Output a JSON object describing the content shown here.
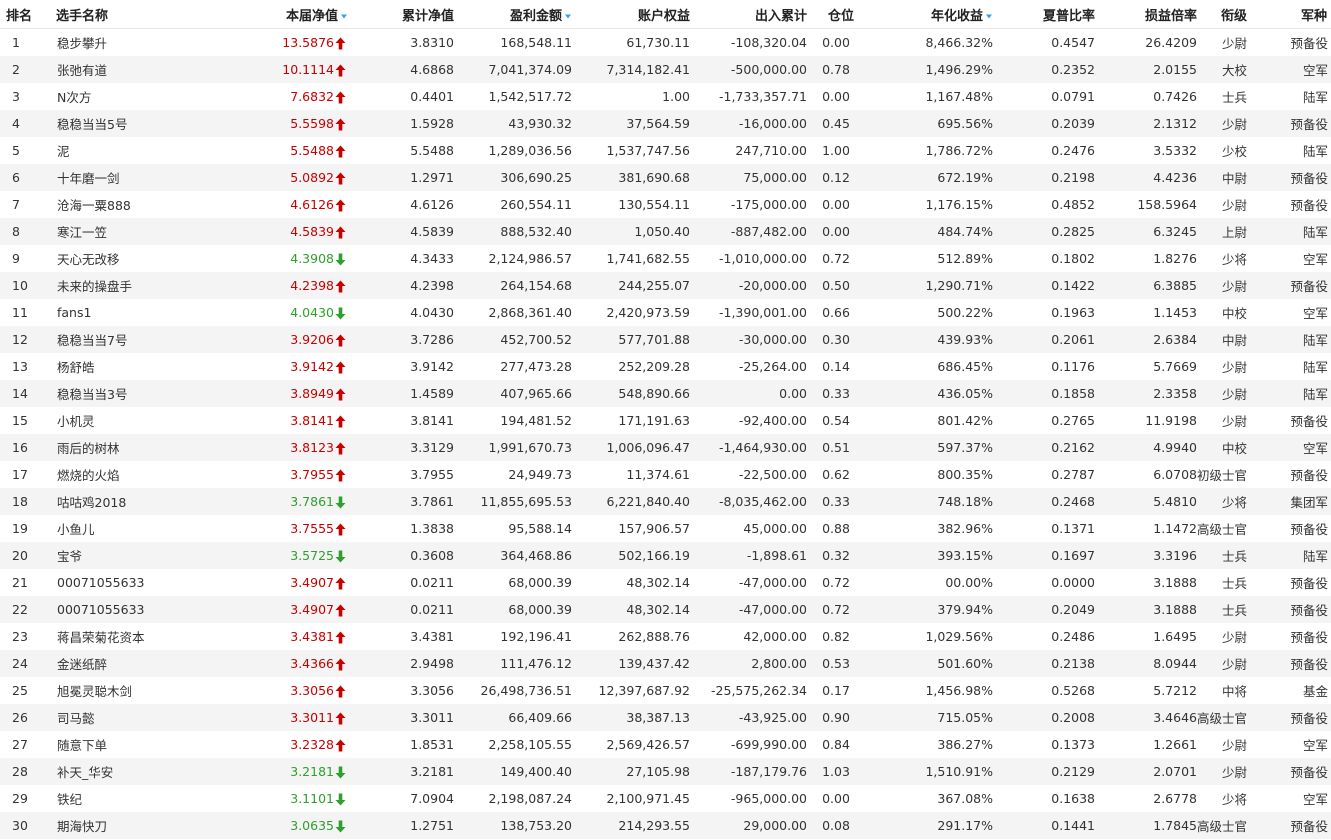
{
  "colors": {
    "up": "#c80000",
    "down": "#2da02d",
    "sort_icon": "#3aa0e6",
    "stripe": "#f4f4f4"
  },
  "header": {
    "rank": "排名",
    "name": "选手名称",
    "nav": "本届净值",
    "cum_nav": "累计净值",
    "profit": "盈利金额",
    "equity": "账户权益",
    "inout": "出入累计",
    "position": "仓位",
    "annual": "年化收益",
    "sharpe": "夏普比率",
    "pl_ratio": "损益倍率",
    "rank_title": "衔级",
    "army": "军种"
  },
  "sortable_icon": "sort-down-triangle-icon",
  "rows": [
    {
      "rank": "1",
      "name": "稳步攀升",
      "nav": "13.5876",
      "dir": "up",
      "cum_nav": "3.8310",
      "profit": "168,548.11",
      "equity": "61,730.11",
      "inout": "-108,320.04",
      "position": "0.00",
      "annual": "8,466.32%",
      "sharpe": "0.4547",
      "pl_ratio": "26.4209",
      "title": "少尉",
      "army": "预备役"
    },
    {
      "rank": "2",
      "name": "张弛有道",
      "nav": "10.1114",
      "dir": "up",
      "cum_nav": "4.6868",
      "profit": "7,041,374.09",
      "equity": "7,314,182.41",
      "inout": "-500,000.00",
      "position": "0.78",
      "annual": "1,496.29%",
      "sharpe": "0.2352",
      "pl_ratio": "2.0155",
      "title": "大校",
      "army": "空军"
    },
    {
      "rank": "3",
      "name": "N次方",
      "nav": "7.6832",
      "dir": "up",
      "cum_nav": "0.4401",
      "profit": "1,542,517.72",
      "equity": "1.00",
      "inout": "-1,733,357.71",
      "position": "0.00",
      "annual": "1,167.48%",
      "sharpe": "0.0791",
      "pl_ratio": "0.7426",
      "title": "士兵",
      "army": "陆军"
    },
    {
      "rank": "4",
      "name": "稳稳当当5号",
      "nav": "5.5598",
      "dir": "up",
      "cum_nav": "1.5928",
      "profit": "43,930.32",
      "equity": "37,564.59",
      "inout": "-16,000.00",
      "position": "0.45",
      "annual": "695.56%",
      "sharpe": "0.2039",
      "pl_ratio": "2.1312",
      "title": "少尉",
      "army": "预备役"
    },
    {
      "rank": "5",
      "name": "泥",
      "nav": "5.5488",
      "dir": "up",
      "cum_nav": "5.5488",
      "profit": "1,289,036.56",
      "equity": "1,537,747.56",
      "inout": "247,710.00",
      "position": "1.00",
      "annual": "1,786.72%",
      "sharpe": "0.2476",
      "pl_ratio": "3.5332",
      "title": "少校",
      "army": "陆军"
    },
    {
      "rank": "6",
      "name": "十年磨一剑",
      "nav": "5.0892",
      "dir": "up",
      "cum_nav": "1.2971",
      "profit": "306,690.25",
      "equity": "381,690.68",
      "inout": "75,000.00",
      "position": "0.12",
      "annual": "672.19%",
      "sharpe": "0.2198",
      "pl_ratio": "4.4236",
      "title": "中尉",
      "army": "预备役"
    },
    {
      "rank": "7",
      "name": "沧海一粟888",
      "nav": "4.6126",
      "dir": "up",
      "cum_nav": "4.6126",
      "profit": "260,554.11",
      "equity": "130,554.11",
      "inout": "-175,000.00",
      "position": "0.00",
      "annual": "1,176.15%",
      "sharpe": "0.4852",
      "pl_ratio": "158.5964",
      "title": "少尉",
      "army": "预备役"
    },
    {
      "rank": "8",
      "name": "寒江一笠",
      "nav": "4.5839",
      "dir": "up",
      "cum_nav": "4.5839",
      "profit": "888,532.40",
      "equity": "1,050.40",
      "inout": "-887,482.00",
      "position": "0.00",
      "annual": "484.74%",
      "sharpe": "0.2825",
      "pl_ratio": "6.3245",
      "title": "上尉",
      "army": "陆军"
    },
    {
      "rank": "9",
      "name": "天心无改移",
      "nav": "4.3908",
      "dir": "down",
      "cum_nav": "4.3433",
      "profit": "2,124,986.57",
      "equity": "1,741,682.55",
      "inout": "-1,010,000.00",
      "position": "0.72",
      "annual": "512.89%",
      "sharpe": "0.1802",
      "pl_ratio": "1.8276",
      "title": "少将",
      "army": "空军"
    },
    {
      "rank": "10",
      "name": "未来的操盘手",
      "nav": "4.2398",
      "dir": "up",
      "cum_nav": "4.2398",
      "profit": "264,154.68",
      "equity": "244,255.07",
      "inout": "-20,000.00",
      "position": "0.50",
      "annual": "1,290.71%",
      "sharpe": "0.1422",
      "pl_ratio": "6.3885",
      "title": "少尉",
      "army": "预备役"
    },
    {
      "rank": "11",
      "name": "fans1",
      "nav": "4.0430",
      "dir": "down",
      "cum_nav": "4.0430",
      "profit": "2,868,361.40",
      "equity": "2,420,973.59",
      "inout": "-1,390,001.00",
      "position": "0.66",
      "annual": "500.22%",
      "sharpe": "0.1963",
      "pl_ratio": "1.1453",
      "title": "中校",
      "army": "空军"
    },
    {
      "rank": "12",
      "name": "稳稳当当7号",
      "nav": "3.9206",
      "dir": "up",
      "cum_nav": "3.7286",
      "profit": "452,700.52",
      "equity": "577,701.88",
      "inout": "-30,000.00",
      "position": "0.30",
      "annual": "439.93%",
      "sharpe": "0.2061",
      "pl_ratio": "2.6384",
      "title": "中尉",
      "army": "陆军"
    },
    {
      "rank": "13",
      "name": "杨舒皓",
      "nav": "3.9142",
      "dir": "up",
      "cum_nav": "3.9142",
      "profit": "277,473.28",
      "equity": "252,209.28",
      "inout": "-25,264.00",
      "position": "0.14",
      "annual": "686.45%",
      "sharpe": "0.1176",
      "pl_ratio": "5.7669",
      "title": "少尉",
      "army": "陆军"
    },
    {
      "rank": "14",
      "name": "稳稳当当3号",
      "nav": "3.8949",
      "dir": "up",
      "cum_nav": "1.4589",
      "profit": "407,965.66",
      "equity": "548,890.66",
      "inout": "0.00",
      "position": "0.33",
      "annual": "436.05%",
      "sharpe": "0.1858",
      "pl_ratio": "2.3358",
      "title": "少尉",
      "army": "陆军"
    },
    {
      "rank": "15",
      "name": "小机灵",
      "nav": "3.8141",
      "dir": "up",
      "cum_nav": "3.8141",
      "profit": "194,481.52",
      "equity": "171,191.63",
      "inout": "-92,400.00",
      "position": "0.54",
      "annual": "801.42%",
      "sharpe": "0.2765",
      "pl_ratio": "11.9198",
      "title": "少尉",
      "army": "预备役"
    },
    {
      "rank": "16",
      "name": "雨后的树林",
      "nav": "3.8123",
      "dir": "up",
      "cum_nav": "3.3129",
      "profit": "1,991,670.73",
      "equity": "1,006,096.47",
      "inout": "-1,464,930.00",
      "position": "0.51",
      "annual": "597.37%",
      "sharpe": "0.2162",
      "pl_ratio": "4.9940",
      "title": "中校",
      "army": "空军"
    },
    {
      "rank": "17",
      "name": "燃烧的火焰",
      "nav": "3.7955",
      "dir": "up",
      "cum_nav": "3.7955",
      "profit": "24,949.73",
      "equity": "11,374.61",
      "inout": "-22,500.00",
      "position": "0.62",
      "annual": "800.35%",
      "sharpe": "0.2787",
      "pl_ratio": "6.0708",
      "title": "初级士官",
      "army": "预备役"
    },
    {
      "rank": "18",
      "name": "咕咕鸡2018",
      "nav": "3.7861",
      "dir": "down",
      "cum_nav": "3.7861",
      "profit": "11,855,695.53",
      "equity": "6,221,840.40",
      "inout": "-8,035,462.00",
      "position": "0.33",
      "annual": "748.18%",
      "sharpe": "0.2468",
      "pl_ratio": "5.4810",
      "title": "少将",
      "army": "集团军"
    },
    {
      "rank": "19",
      "name": "小鱼儿",
      "nav": "3.7555",
      "dir": "up",
      "cum_nav": "1.3838",
      "profit": "95,588.14",
      "equity": "157,906.57",
      "inout": "45,000.00",
      "position": "0.88",
      "annual": "382.96%",
      "sharpe": "0.1371",
      "pl_ratio": "1.1472",
      "title": "高级士官",
      "army": "预备役"
    },
    {
      "rank": "20",
      "name": "宝爷",
      "nav": "3.5725",
      "dir": "down",
      "cum_nav": "0.3608",
      "profit": "364,468.86",
      "equity": "502,166.19",
      "inout": "-1,898.61",
      "position": "0.32",
      "annual": "393.15%",
      "sharpe": "0.1697",
      "pl_ratio": "3.3196",
      "title": "士兵",
      "army": "陆军"
    },
    {
      "rank": "21",
      "name": "00071055633",
      "nav": "3.4907",
      "dir": "up",
      "cum_nav": "0.0211",
      "profit": "68,000.39",
      "equity": "48,302.14",
      "inout": "-47,000.00",
      "position": "0.72",
      "annual": "00.00%",
      "sharpe": "0.0000",
      "pl_ratio": "3.1888",
      "title": "士兵",
      "army": "预备役"
    },
    {
      "rank": "22",
      "name": "00071055633",
      "nav": "3.4907",
      "dir": "up",
      "cum_nav": "0.0211",
      "profit": "68,000.39",
      "equity": "48,302.14",
      "inout": "-47,000.00",
      "position": "0.72",
      "annual": "379.94%",
      "sharpe": "0.2049",
      "pl_ratio": "3.1888",
      "title": "士兵",
      "army": "预备役"
    },
    {
      "rank": "23",
      "name": "蒋昌荣菊花资本",
      "nav": "3.4381",
      "dir": "up",
      "cum_nav": "3.4381",
      "profit": "192,196.41",
      "equity": "262,888.76",
      "inout": "42,000.00",
      "position": "0.82",
      "annual": "1,029.56%",
      "sharpe": "0.2486",
      "pl_ratio": "1.6495",
      "title": "少尉",
      "army": "预备役"
    },
    {
      "rank": "24",
      "name": "金迷纸醉",
      "nav": "3.4366",
      "dir": "up",
      "cum_nav": "2.9498",
      "profit": "111,476.12",
      "equity": "139,437.42",
      "inout": "2,800.00",
      "position": "0.53",
      "annual": "501.60%",
      "sharpe": "0.2138",
      "pl_ratio": "8.0944",
      "title": "少尉",
      "army": "预备役"
    },
    {
      "rank": "25",
      "name": "旭冕灵聪木剑",
      "nav": "3.3056",
      "dir": "up",
      "cum_nav": "3.3056",
      "profit": "26,498,736.51",
      "equity": "12,397,687.92",
      "inout": "-25,575,262.34",
      "position": "0.17",
      "annual": "1,456.98%",
      "sharpe": "0.5268",
      "pl_ratio": "5.7212",
      "title": "中将",
      "army": "基金"
    },
    {
      "rank": "26",
      "name": "司马懿",
      "nav": "3.3011",
      "dir": "up",
      "cum_nav": "3.3011",
      "profit": "66,409.66",
      "equity": "38,387.13",
      "inout": "-43,925.00",
      "position": "0.90",
      "annual": "715.05%",
      "sharpe": "0.2008",
      "pl_ratio": "3.4646",
      "title": "高级士官",
      "army": "预备役"
    },
    {
      "rank": "27",
      "name": "随意下单",
      "nav": "3.2328",
      "dir": "up",
      "cum_nav": "1.8531",
      "profit": "2,258,105.55",
      "equity": "2,569,426.57",
      "inout": "-699,990.00",
      "position": "0.84",
      "annual": "386.27%",
      "sharpe": "0.1373",
      "pl_ratio": "1.2661",
      "title": "少尉",
      "army": "空军"
    },
    {
      "rank": "28",
      "name": "补天_华安",
      "nav": "3.2181",
      "dir": "down",
      "cum_nav": "3.2181",
      "profit": "149,400.40",
      "equity": "27,105.98",
      "inout": "-187,179.76",
      "position": "1.03",
      "annual": "1,510.91%",
      "sharpe": "0.2129",
      "pl_ratio": "2.0701",
      "title": "少尉",
      "army": "预备役"
    },
    {
      "rank": "29",
      "name": "铁纪",
      "nav": "3.1101",
      "dir": "down",
      "cum_nav": "7.0904",
      "profit": "2,198,087.24",
      "equity": "2,100,971.45",
      "inout": "-965,000.00",
      "position": "0.00",
      "annual": "367.08%",
      "sharpe": "0.1638",
      "pl_ratio": "2.6778",
      "title": "少将",
      "army": "空军"
    },
    {
      "rank": "30",
      "name": "期海快刀",
      "nav": "3.0635",
      "dir": "down",
      "cum_nav": "1.2751",
      "profit": "138,753.20",
      "equity": "214,293.55",
      "inout": "29,000.00",
      "position": "0.08",
      "annual": "291.17%",
      "sharpe": "0.1441",
      "pl_ratio": "1.7845",
      "title": "高级士官",
      "army": "预备役"
    }
  ]
}
